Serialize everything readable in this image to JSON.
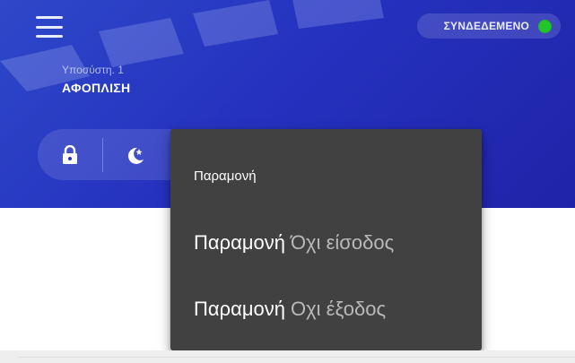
{
  "header": {
    "status_text": "ΣΥΝΔΕΔΕΜΕΝΟ",
    "status_color": "#22c52a",
    "partition_label": "Υποσύστη. 1",
    "arm_status": "ΑΦΟΠΛΙΣΗ"
  },
  "icons": {
    "menu": "menu-icon",
    "lock": "lock-icon",
    "moon": "moon-stay-icon"
  },
  "dropdown": {
    "header": "Παραμονή",
    "items": [
      {
        "main": "Παραμονή",
        "sub": "Όχι είσοδος"
      },
      {
        "main": "Παραμονή",
        "sub": "Οχι έξοδος"
      }
    ]
  },
  "colors": {
    "header_gradient_start": "#2e48c9",
    "header_gradient_end": "#1f23a8",
    "dropdown_bg": "#414141"
  }
}
